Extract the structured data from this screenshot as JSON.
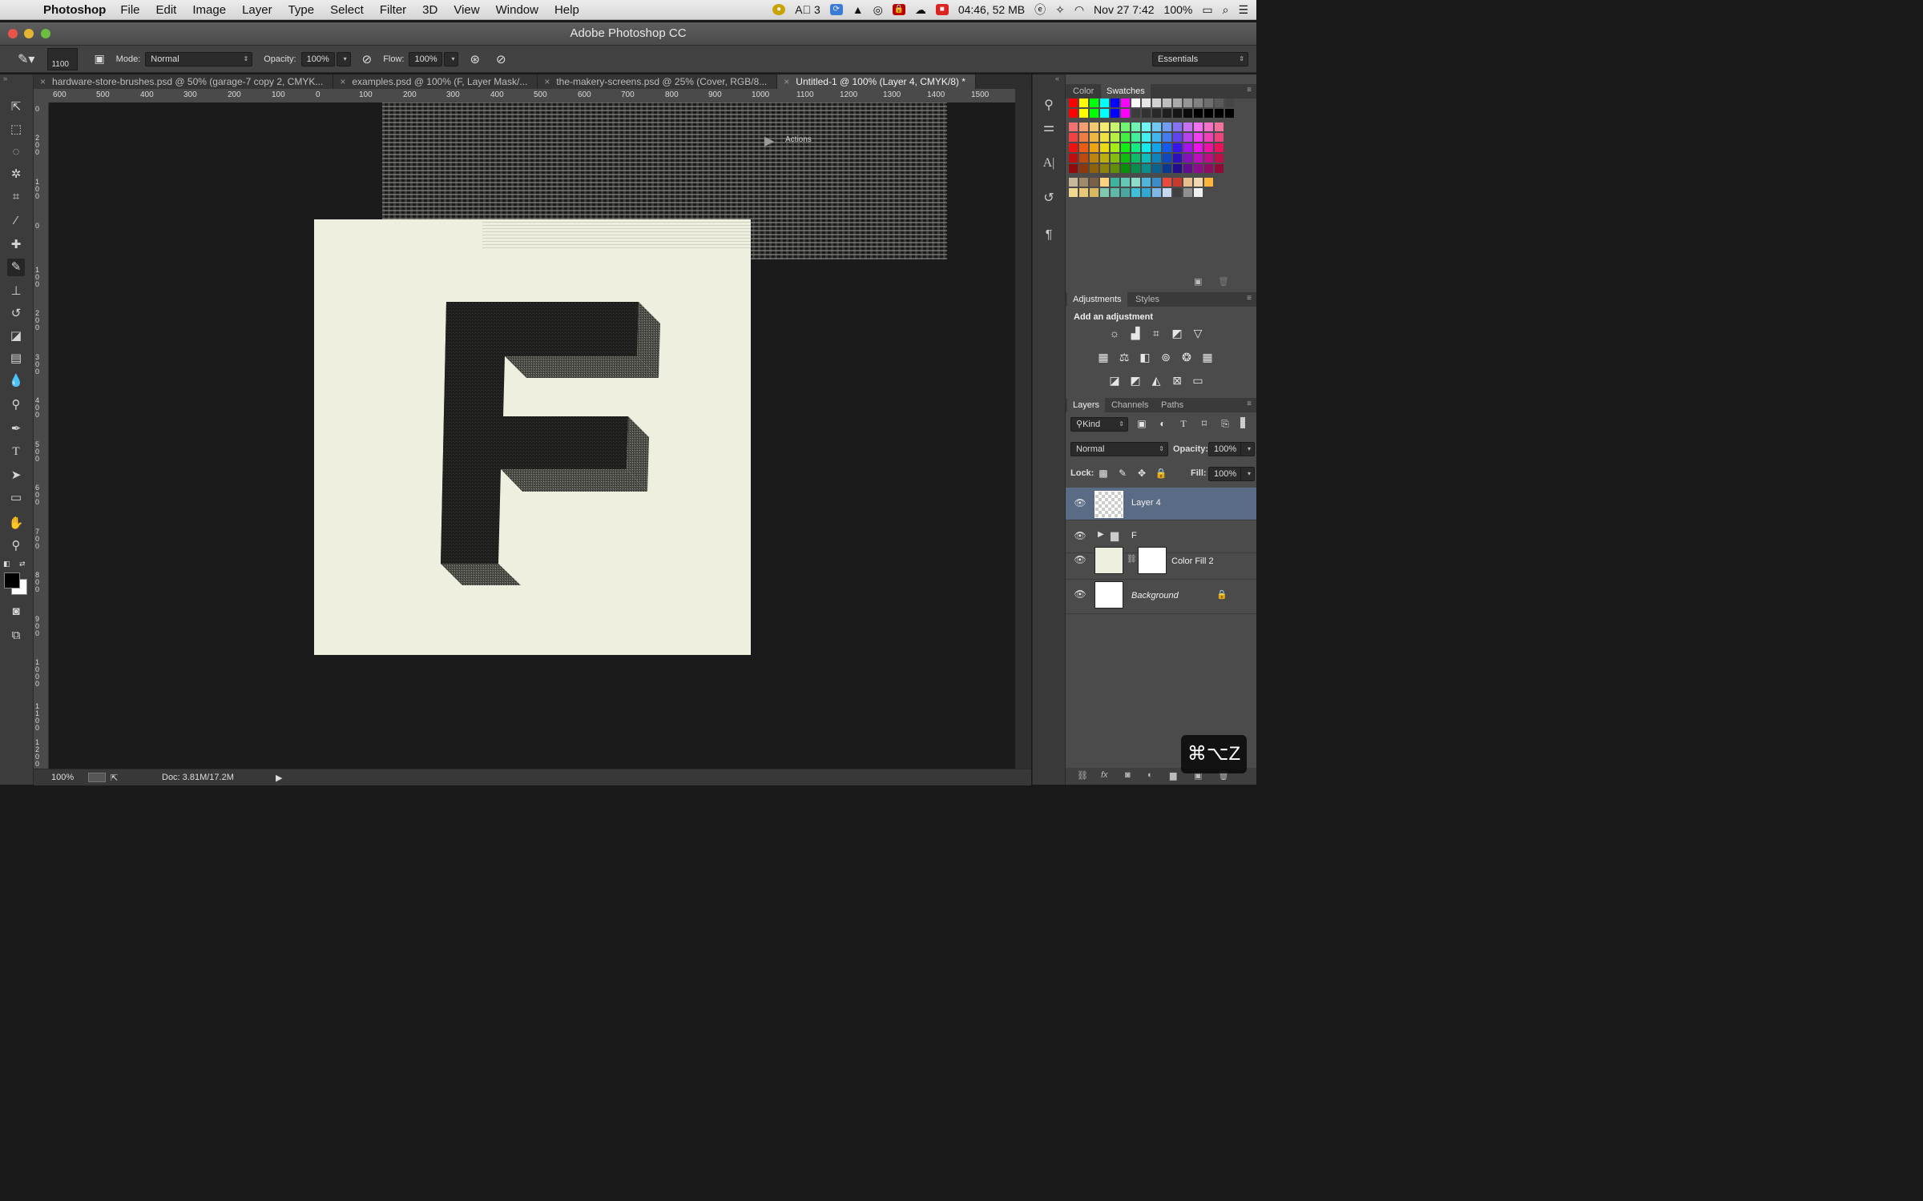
{
  "menubar": {
    "app_name": "Photoshop",
    "menus": [
      "File",
      "Edit",
      "Image",
      "Layer",
      "Type",
      "Select",
      "Filter",
      "3D",
      "View",
      "Window",
      "Help"
    ],
    "status_3": "3",
    "battery_time": "04:46, 52 MB",
    "date_time": "Nov 27  7:42",
    "battery_percent": "100%"
  },
  "window": {
    "title": "Adobe Photoshop CC"
  },
  "options": {
    "brush_size": "1100",
    "mode_label": "Mode:",
    "mode_value": "Normal",
    "opacity_label": "Opacity:",
    "opacity_value": "100%",
    "flow_label": "Flow:",
    "flow_value": "100%",
    "workspace": "Essentials"
  },
  "tabs": [
    {
      "label": "hardware-store-brushes.psd @ 50% (garage-7 copy 2, CMYK..."
    },
    {
      "label": "examples.psd @ 100% (F, Layer Mask/..."
    },
    {
      "label": "the-makery-screens.psd @ 25% (Cover, RGB/8..."
    },
    {
      "label": "Untitled-1 @ 100% (Layer 4, CMYK/8) *"
    }
  ],
  "rulers": {
    "h": [
      "600",
      "500",
      "400",
      "300",
      "200",
      "100",
      "0",
      "100",
      "200",
      "300",
      "400",
      "500",
      "600",
      "700",
      "800",
      "900",
      "1000",
      "1100",
      "1200",
      "1300",
      "1400",
      "1500"
    ],
    "v": [
      "0",
      "200",
      "100",
      "0",
      "100",
      "200",
      "300",
      "400",
      "500",
      "600",
      "700",
      "800",
      "900",
      "1000",
      "1100",
      "1200"
    ]
  },
  "canvas": {
    "overlay_label": "Actions",
    "doc_bg": "#efefe0"
  },
  "status": {
    "zoom": "100%",
    "doc_size": "Doc: 3.81M/17.2M"
  },
  "panels": {
    "color_tab": "Color",
    "swatches_tab": "Swatches",
    "adjustments_tab": "Adjustments",
    "styles_tab": "Styles",
    "add_adjustment": "Add an adjustment",
    "layers_tab": "Layers",
    "channels_tab": "Channels",
    "paths_tab": "Paths",
    "kind_label": "Kind",
    "blend_mode": "Normal",
    "opacity_label": "Opacity:",
    "opacity_value": "100%",
    "lock_label": "Lock:",
    "fill_label": "Fill:",
    "fill_value": "100%"
  },
  "layers": [
    {
      "name": "Layer 4",
      "selected": true
    },
    {
      "name": "F"
    },
    {
      "name": "Color Fill 2"
    },
    {
      "name": "Background"
    }
  ],
  "shortcut": "⌘⌥Z"
}
